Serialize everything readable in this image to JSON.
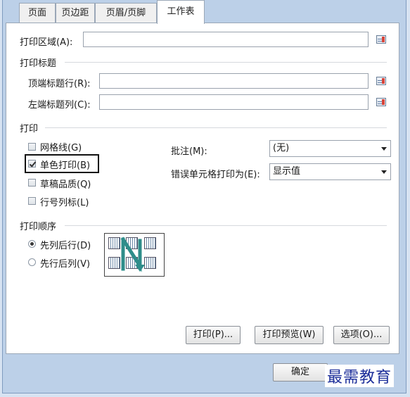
{
  "tabs": [
    {
      "label": "页面"
    },
    {
      "label": "页边距"
    },
    {
      "label": "页眉/页脚"
    },
    {
      "label": "工作表"
    }
  ],
  "print_area": {
    "label": "打印区域(A):",
    "value": ""
  },
  "print_titles": {
    "heading": "打印标题",
    "rows_label": "顶端标题行(R):",
    "rows_value": "",
    "cols_label": "左端标题列(C):",
    "cols_value": ""
  },
  "print": {
    "heading": "打印",
    "gridlines": {
      "label": "网格线(G)",
      "checked": false
    },
    "black_white": {
      "label": "单色打印(B)",
      "checked": true
    },
    "draft": {
      "label": "草稿品质(Q)",
      "checked": false
    },
    "headings": {
      "label": "行号列标(L)",
      "checked": false
    },
    "comments": {
      "label": "批注(M):",
      "value": "(无)"
    },
    "errors": {
      "label": "错误单元格打印为(E):",
      "value": "显示值"
    }
  },
  "page_order": {
    "heading": "打印顺序",
    "down_then_over": {
      "label": "先列后行(D)",
      "selected": true
    },
    "over_then_down": {
      "label": "先行后列(V)",
      "selected": false
    }
  },
  "buttons": {
    "print": "打印(P)...",
    "preview": "打印预览(W)",
    "options": "选项(O)...",
    "ok": "确定"
  },
  "watermark": "最需教育"
}
